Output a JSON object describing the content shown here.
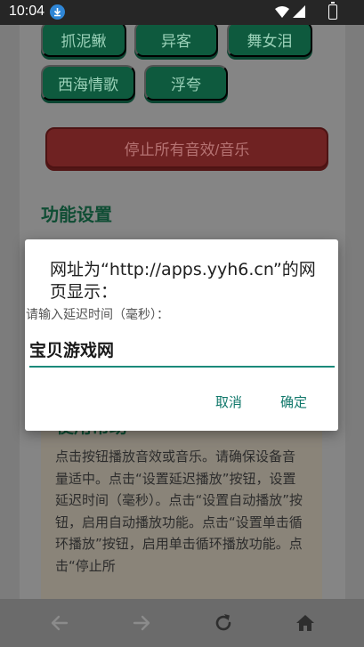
{
  "status_bar": {
    "time": "10:04",
    "icons": [
      "download-icon",
      "wifi-icon",
      "signal-icon",
      "battery-icon"
    ]
  },
  "page": {
    "sound_buttons": [
      {
        "label": "抓泥鳅"
      },
      {
        "label": "异客"
      },
      {
        "label": "舞女泪"
      },
      {
        "label": "西海情歌"
      },
      {
        "label": "浮夸"
      }
    ],
    "stop_button": "停止所有音效/音乐",
    "settings_title": "功能设置",
    "help_title": "使用帮助",
    "help_text": "点击按钮播放音效或音乐。请确保设备音量适中。点击“设置延迟播放”按钮，设置延迟时间（毫秒）。点击“设置自动播放”按钮，启用自动播放功能。点击“设置单击循环播放”按钮，启用单击循环播放功能。点击“停止所"
  },
  "dialog": {
    "title": "网址为“http://apps.yyh6.cn”的网页显示：",
    "message": "请输入延迟时间（毫秒）：",
    "input_value": "宝贝游戏网",
    "cancel_label": "取消",
    "ok_label": "确定"
  },
  "nav_bar": {
    "icons": [
      "back-arrow-icon",
      "forward-arrow-icon",
      "refresh-icon",
      "home-icon"
    ]
  },
  "colors": {
    "accent": "#11786b",
    "sound_button": "#0e5a3e",
    "stop_button": "#6f2222"
  }
}
